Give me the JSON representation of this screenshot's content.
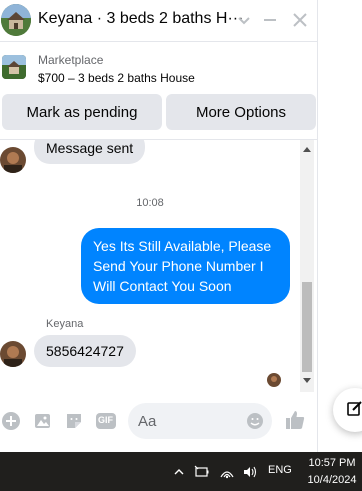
{
  "header": {
    "title": "Keyana · 3 beds 2 baths H···",
    "avatar_icon": "house-photo-avatar",
    "icons": [
      "chevron-down-icon",
      "minimize-icon",
      "close-icon"
    ]
  },
  "listing": {
    "label": "Marketplace",
    "description": "$700 – 3 beds 2 baths House"
  },
  "actions": {
    "mark_pending_label": "Mark as pending",
    "more_options_label": "More Options"
  },
  "thread": {
    "messages": [
      {
        "direction": "in",
        "text": "Message sent"
      },
      {
        "timestamp": "10:08"
      },
      {
        "direction": "out",
        "lines": [
          "Yes Its Still Available, Please",
          "Send Your Phone Number I",
          "Will Contact You Soon"
        ]
      },
      {
        "direction": "in",
        "sender": "Keyana",
        "text": "5856424727"
      }
    ],
    "read_receipt_icon": "seen-avatar-icon"
  },
  "composer": {
    "placeholder": "Aa",
    "icons": [
      "plus-circle-icon",
      "photo-icon",
      "sticker-icon",
      "gif-icon",
      "emoji-icon",
      "like-thumb-icon"
    ],
    "gif_label": "GIF"
  },
  "taskbar": {
    "language": "ENG",
    "time": "10:57 PM",
    "date": "10/4/2024",
    "icons": [
      "chevron-up-icon",
      "battery-icon",
      "wifi-icon",
      "volume-icon"
    ]
  },
  "colors": {
    "accent": "#0084ff",
    "bubble_in": "#e4e6eb",
    "taskbar": "#201f1d",
    "muted_text": "#65676b"
  }
}
